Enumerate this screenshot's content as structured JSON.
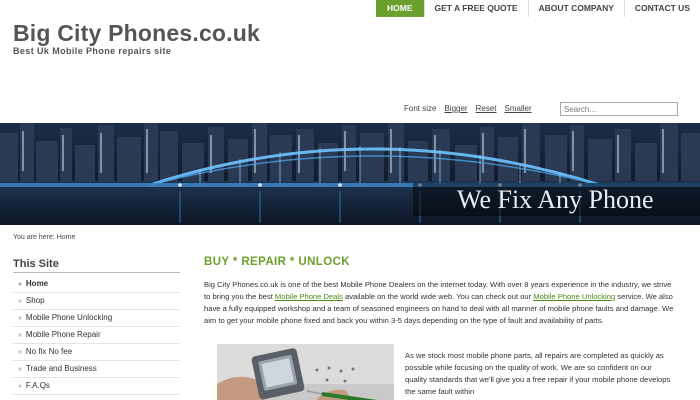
{
  "nav": {
    "items": [
      {
        "label": "HOME",
        "active": true
      },
      {
        "label": "GET A FREE QUOTE",
        "active": false
      },
      {
        "label": "ABOUT COMPANY",
        "active": false
      },
      {
        "label": "CONTACT US",
        "active": false
      }
    ]
  },
  "header": {
    "title": "Big City Phones.co.uk",
    "tagline": "Best Uk Mobile Phone repairs site"
  },
  "fontsize": {
    "label": "Font size",
    "bigger": "Bigger",
    "reset": "Reset",
    "smaller": "Smaller"
  },
  "search": {
    "placeholder": "Search..."
  },
  "banner": {
    "text": "We Fix Any Phone"
  },
  "breadcrumb": {
    "prefix": "You are here:",
    "current": "Home"
  },
  "sidebar": {
    "title": "This Site",
    "items": [
      {
        "label": "Home"
      },
      {
        "label": "Shop"
      },
      {
        "label": "Mobile Phone Unlocking"
      },
      {
        "label": "Mobile Phone Repair"
      },
      {
        "label": "No fix No fee"
      },
      {
        "label": "Trade and Business"
      },
      {
        "label": "F.A.Qs"
      }
    ]
  },
  "content": {
    "title": "BUY * REPAIR * UNLOCK",
    "p1_a": "Big City Phones.co.uk is one of the best Mobile Phone Dealers on the internet today. With over 8 years experience in the industry, we strive to bring you the best ",
    "p1_link1": "Mobile Phone Deals",
    "p1_b": " available on the world wide web. You can check out our ",
    "p1_link2": "Mobile Phone Unlocking",
    "p1_c": " service. We also have a fully  equipped workshop  and a team of seasoned engineers on hand to deal with all manner of mobile phone faults and damage.  We aim to get your mobile phone fixed and back you within 3-5 days depending on the type of fault and availability of parts.",
    "p2": "As we stock most mobile phone parts, all repairs are completed as quickly as possible while focusing on the quality of work. We are so confident on our quality standards that we'll give you a free repair if your mobile phone develops the same fault within"
  },
  "colors": {
    "accent": "#6aa02b"
  }
}
